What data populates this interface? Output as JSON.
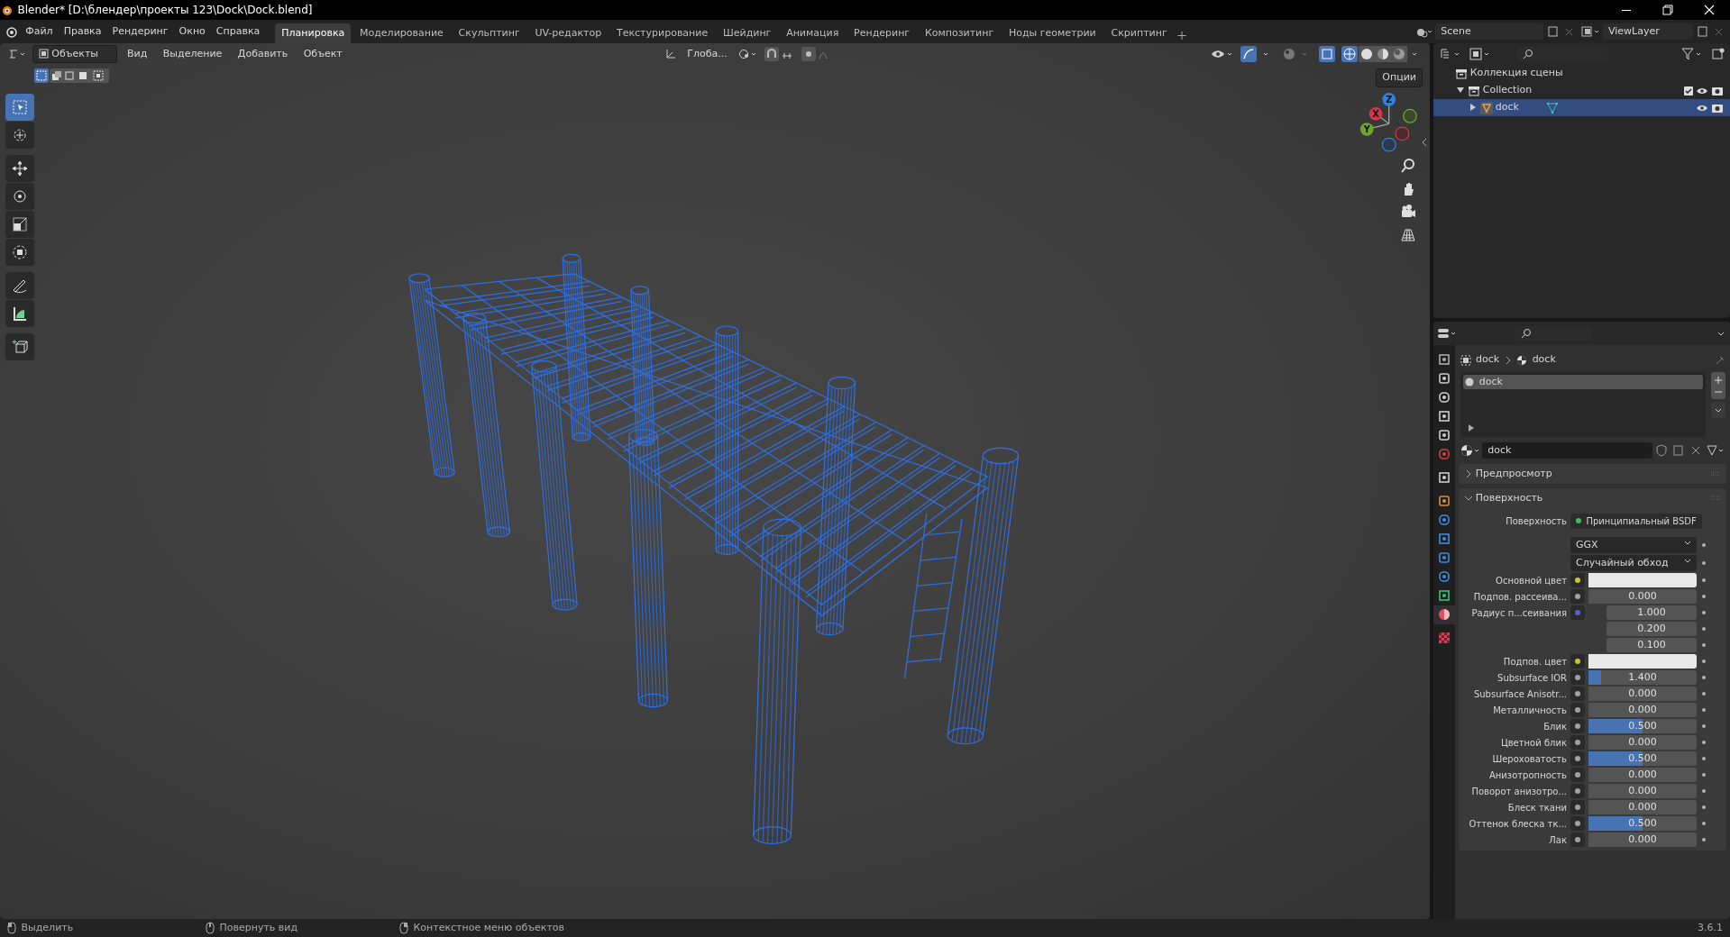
{
  "window": {
    "title": "Blender* [D:\\блендер\\проекты 123\\Dock\\Dock.blend]"
  },
  "menu": [
    "Файл",
    "Правка",
    "Рендеринг",
    "Окно",
    "Справка"
  ],
  "workspaces": [
    {
      "label": "Планировка",
      "selected": true
    },
    {
      "label": "Моделирование",
      "selected": false
    },
    {
      "label": "Скульптинг",
      "selected": false
    },
    {
      "label": "UV-редактор",
      "selected": false
    },
    {
      "label": "Текстурирование",
      "selected": false
    },
    {
      "label": "Шейдинг",
      "selected": false
    },
    {
      "label": "Анимация",
      "selected": false
    },
    {
      "label": "Рендеринг",
      "selected": false
    },
    {
      "label": "Композитинг",
      "selected": false
    },
    {
      "label": "Ноды геометрии",
      "selected": false
    },
    {
      "label": "Скриптинг",
      "selected": false
    }
  ],
  "scene": {
    "name": "Scene"
  },
  "view_layer": {
    "name": "ViewLayer"
  },
  "viewport": {
    "mode": "Объекты",
    "menus": [
      "Вид",
      "Выделение",
      "Добавить",
      "Объект"
    ],
    "orientation": "Глоба...",
    "options": "Опции",
    "gizmo_axes": [
      "Z",
      "X",
      "Y"
    ],
    "tools": [
      {
        "selected": true
      },
      {
        "selected": false
      },
      {
        "selected": false
      },
      {
        "selected": false
      },
      {
        "selected": false
      },
      {
        "selected": false
      },
      {
        "selected": false
      },
      {
        "selected": false
      },
      {
        "selected": false
      }
    ]
  },
  "outliner": {
    "tree": [
      {
        "label": "Коллекция сцены",
        "kind": "scene",
        "selected": false,
        "children": [
          {
            "label": "Collection",
            "kind": "collection",
            "selected": false,
            "expanded": true,
            "children": [
              {
                "label": "dock",
                "kind": "object",
                "selected": true,
                "expanded": false
              }
            ]
          }
        ]
      }
    ]
  },
  "properties": {
    "tabs": [
      {
        "selected": false
      },
      {
        "selected": false
      },
      {
        "selected": false
      },
      {
        "selected": false
      },
      {
        "selected": false
      },
      {
        "selected": false
      },
      {
        "selected": false
      },
      {
        "selected": false
      },
      {
        "selected": false
      },
      {
        "selected": false
      },
      {
        "selected": false
      },
      {
        "selected": false
      },
      {
        "selected": false
      },
      {
        "selected": true
      },
      {
        "selected": false
      }
    ],
    "breadcrumb": [
      "dock",
      "dock"
    ],
    "slots": [
      {
        "name": "dock",
        "selected": true
      }
    ],
    "material": "dock",
    "panels": [
      {
        "title": "Предпросмотр",
        "expanded": false
      },
      {
        "title": "Поверхность",
        "expanded": true
      }
    ],
    "surface_label": "Поверхность",
    "surface_shader": "Принципиальный BSDF",
    "dropdowns": [
      "GGX",
      "Случайный обход"
    ],
    "inputs": [
      {
        "label": "Основной цвет",
        "kind": "color"
      },
      {
        "label": "Подпов. рассеива...",
        "kind": "value",
        "value": "0.000",
        "level": 0
      },
      {
        "label": "Радиус п...сеивания",
        "kind": "vector",
        "values": [
          "1.000",
          "0.200",
          "0.100"
        ]
      },
      {
        "label": "Подпов. цвет",
        "kind": "color"
      },
      {
        "label": "Subsurface IOR",
        "kind": "value",
        "value": "1.400",
        "level": 0.12
      },
      {
        "label": "Subsurface Anisotr...",
        "kind": "value",
        "value": "0.000",
        "level": 0
      },
      {
        "label": "Металличность",
        "kind": "value",
        "value": "0.000",
        "level": 0
      },
      {
        "label": "Блик",
        "kind": "value",
        "value": "0.500",
        "level": 0.5
      },
      {
        "label": "Цветной блик",
        "kind": "value",
        "value": "0.000",
        "level": 0
      },
      {
        "label": "Шероховатость",
        "kind": "value",
        "value": "0.500",
        "level": 0.5
      },
      {
        "label": "Анизотропность",
        "kind": "value",
        "value": "0.000",
        "level": 0
      },
      {
        "label": "Поворот анизотро...",
        "kind": "value",
        "value": "0.000",
        "level": 0
      },
      {
        "label": "Блеск ткани",
        "kind": "value",
        "value": "0.000",
        "level": 0
      },
      {
        "label": "Оттенок блеска тк...",
        "kind": "value",
        "value": "0.500",
        "level": 0.5
      },
      {
        "label": "Лак",
        "kind": "value",
        "value": "0.000",
        "level": 0
      }
    ]
  },
  "status_bar": {
    "hints": [
      "Выделить",
      "Повернуть вид",
      "Контекстное меню объектов"
    ],
    "version": "3.6.1"
  }
}
